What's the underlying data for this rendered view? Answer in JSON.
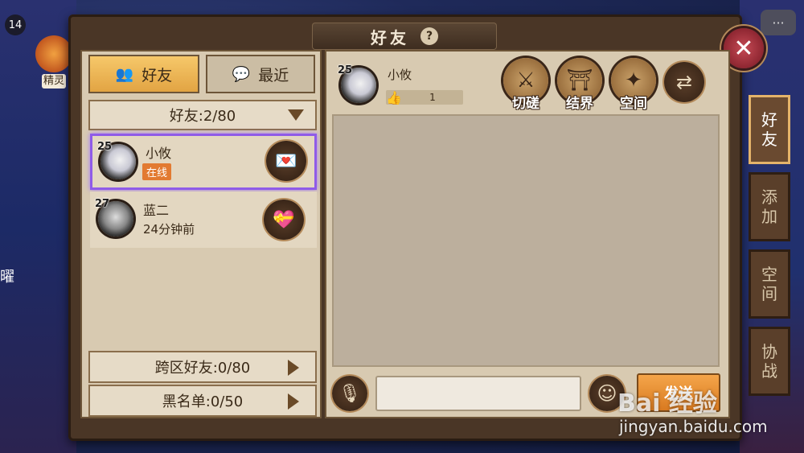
{
  "title": "好友",
  "help_symbol": "?",
  "close_symbol": "✕",
  "player_level": "14",
  "spirit_label": "精灵",
  "chat_bubble_icon": "···",
  "left_edge_text": "曜",
  "tabs": {
    "friends": {
      "label": "好友",
      "icon": "people-icon"
    },
    "recent": {
      "label": "最近",
      "icon": "chat-icon"
    }
  },
  "group_header": {
    "label": "好友:2/80"
  },
  "friends": [
    {
      "level": "25",
      "name": "小攸",
      "status": "在线",
      "online": true
    },
    {
      "level": "27",
      "name": "蓝二",
      "status": "24分钟前",
      "online": false
    }
  ],
  "bottom": {
    "cross_server": "跨区好友:0/80",
    "blacklist": "黑名单:0/50"
  },
  "selected_friend": {
    "level": "25",
    "name": "小攸",
    "likes": "1"
  },
  "actions": [
    {
      "label": "切磋",
      "icon": "duel-icon"
    },
    {
      "label": "结界",
      "icon": "torii-icon"
    },
    {
      "label": "空间",
      "icon": "shuriken-icon"
    }
  ],
  "chat": {
    "input_value": "",
    "send_label": "发送"
  },
  "side_tabs": [
    {
      "label": "好友",
      "active": true
    },
    {
      "label": "添加",
      "active": false
    },
    {
      "label": "空间",
      "active": false
    },
    {
      "label": "协战",
      "active": false
    }
  ],
  "watermark": {
    "logo": "Bai 经验",
    "url": "jingyan.baidu.com"
  },
  "colors": {
    "accent_tab": "#e2a443",
    "online_badge": "#e27a31",
    "selection": "#8f5be8",
    "close_button": "#8e2631"
  }
}
